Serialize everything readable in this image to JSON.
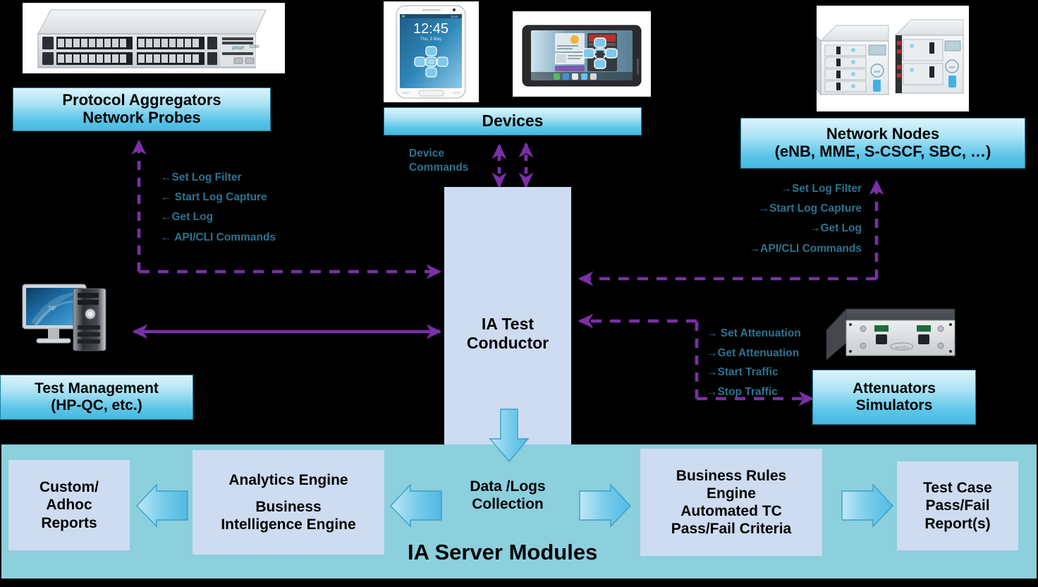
{
  "diagram": {
    "title": "IA Test Conductor Architecture",
    "colors": {
      "cyan_box_top": "#ddf4fc",
      "cyan_box_bottom": "#45b9e0",
      "teal_text": "#2b7390",
      "arrow_purple": "#7b2fa8",
      "band_teal": "#8ccfdd",
      "module_box": "#cddcf0",
      "background": "#000000"
    }
  },
  "boxes": {
    "protocol_aggregators": {
      "lines": [
        "Protocol Aggregators",
        "Network Probes"
      ]
    },
    "devices": {
      "lines": [
        "Devices"
      ]
    },
    "network_nodes": {
      "lines": [
        "Network Nodes",
        "(eNB, MME,  S-CSCF, SBC, …)"
      ]
    },
    "test_management": {
      "lines": [
        "Test Management",
        "(HP-QC, etc.)"
      ]
    },
    "attenuators": {
      "lines": [
        "Attenuators",
        "Simulators"
      ]
    },
    "conductor": {
      "lines": [
        "IA Test",
        "Conductor"
      ]
    }
  },
  "commands": {
    "probes": {
      "label": "probe-commands",
      "items": [
        "←Set Log Filter",
        "← Start Log Capture",
        "←Get Log",
        "← API/CLI Commands"
      ]
    },
    "nodes": {
      "label": "network-node-commands",
      "items": [
        "→Set Log Filter",
        "→Start Log Capture",
        "→Get Log",
        "→API/CLI Commands"
      ]
    },
    "attenuators": {
      "label": "attenuator-commands",
      "items": [
        "→ Set Attenuation",
        "→Get Attenuation",
        "→Start Traffic",
        "→Stop Traffic"
      ]
    },
    "devices": {
      "label": "device-commands",
      "lines": [
        "Device",
        "Commands"
      ]
    }
  },
  "server_modules": {
    "title": "IA Server Modules",
    "items": [
      {
        "name": "custom-adhoc-reports",
        "lines": [
          "Custom/",
          "Adhoc",
          "Reports"
        ]
      },
      {
        "name": "analytics-engine",
        "lines": [
          "Analytics Engine",
          "",
          "Business",
          "Intelligence Engine"
        ]
      },
      {
        "name": "data-logs-collection",
        "lines": [
          "Data /Logs",
          "Collection"
        ]
      },
      {
        "name": "business-rules-engine",
        "lines": [
          "Business Rules",
          "Engine",
          "Automated TC",
          "Pass/Fail  Criteria"
        ]
      },
      {
        "name": "test-case-report",
        "lines": [
          "Test Case",
          "Pass/Fail",
          "Report(s)"
        ]
      }
    ]
  },
  "photos": {
    "network_tap": {
      "name": "anue-network-tap-appliance-photo",
      "brand": "anue",
      "model": "5288"
    },
    "smartphone": {
      "name": "smartphone-photo",
      "screen_time": "12:45",
      "screen_date": "Thu, 3 May"
    },
    "tablet": {
      "name": "tablet-photo"
    },
    "network_nodes": {
      "name": "network-node-chassis-photo"
    },
    "workstation": {
      "name": "desktop-workstation-photo"
    },
    "attenuator": {
      "name": "rf-attenuator-hardware-photo"
    }
  }
}
